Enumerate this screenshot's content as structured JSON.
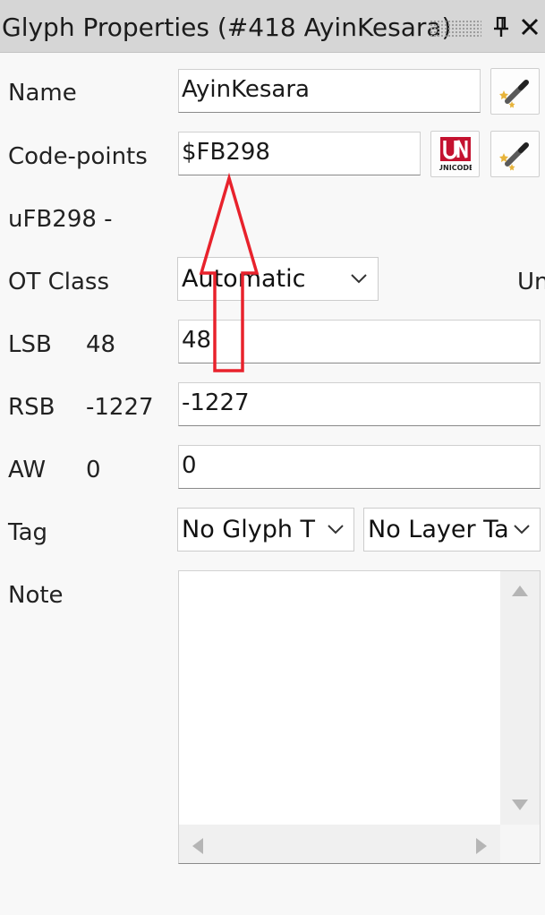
{
  "panel": {
    "title": "Glyph Properties (#418 AyinKesara)",
    "pin_icon": "pin-icon",
    "close_icon": "close-icon"
  },
  "fields": {
    "name_label": "Name",
    "name_value": "AyinKesara",
    "codepoints_label": "Code-points",
    "codepoints_value": "$FB298",
    "unicode_name": "uFB298 -",
    "otclass_label": "OT Class",
    "otclass_value": "Automatic",
    "otclass_extra": "Un",
    "lsb_label": "LSB",
    "lsb_current": "48",
    "lsb_value": "48",
    "rsb_label": "RSB",
    "rsb_current": "-1227",
    "rsb_value": "-1227",
    "aw_label": "AW",
    "aw_current": "0",
    "aw_value": "0",
    "tag_label": "Tag",
    "glyph_tag_value": "No Glyph T",
    "layer_tag_value": "No Layer Ta",
    "note_label": "Note",
    "note_value": ""
  },
  "icons": {
    "auto_name": "magic-wand-icon",
    "unicode_lookup": "unicode-logo-icon",
    "unicode_logo_text": "UNICODE",
    "auto_codepoint": "magic-wand-icon"
  },
  "colors": {
    "annotation_arrow": "#e8222c",
    "titlebar_bg": "#d6d6d6",
    "unicode_logo_red": "#c4122f"
  }
}
